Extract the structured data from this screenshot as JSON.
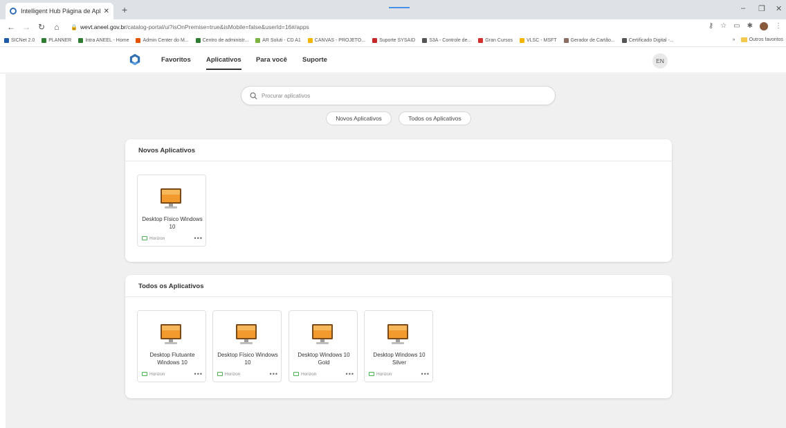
{
  "browser": {
    "tab_title": "Intelligent Hub Página de Aplica",
    "url_domain": "wevt.aneel.gov.br",
    "url_path": "/catalog-portal/ui?isOnPremise=true&isMobile=false&userId=16#/apps",
    "bookmarks": [
      {
        "label": "SICNet 2.0",
        "color": "#1e5aa8"
      },
      {
        "label": "PLANNER",
        "color": "#2e7d32"
      },
      {
        "label": "Intra ANEEL - Home",
        "color": "#2e7d32"
      },
      {
        "label": "Admin Center do M...",
        "color": "#e65100"
      },
      {
        "label": "Centro de administr...",
        "color": "#2e7d32"
      },
      {
        "label": "AR Soluti - CD A1",
        "color": "#7cb342"
      },
      {
        "label": "CANVAS - PROJETO...",
        "color": "#f4b400"
      },
      {
        "label": "Suporte SYSAID",
        "color": "#c62828"
      },
      {
        "label": "S3A - Controle de...",
        "color": "#555555"
      },
      {
        "label": "Gran Cursos",
        "color": "#d32f2f"
      },
      {
        "label": "VLSC - MSFT",
        "color": "#f4b400"
      },
      {
        "label": "Gerador de Cartão...",
        "color": "#8d6e63"
      },
      {
        "label": "Certificado Digital -...",
        "color": "#555555"
      }
    ],
    "other_bookmarks": "Outros favoritos"
  },
  "nav": {
    "items": [
      {
        "label": "Favoritos"
      },
      {
        "label": "Aplicativos"
      },
      {
        "label": "Para você"
      },
      {
        "label": "Suporte"
      }
    ],
    "language": "EN"
  },
  "search": {
    "placeholder": "Procurar aplicativos"
  },
  "filters": [
    {
      "label": "Novos Aplicativos"
    },
    {
      "label": "Todos os Aplicativos"
    }
  ],
  "sections": [
    {
      "title": "Novos Aplicativos",
      "apps": [
        {
          "name": "Desktop Físico Windows 10",
          "source": "Horizon"
        }
      ]
    },
    {
      "title": "Todos os Aplicativos",
      "apps": [
        {
          "name": "Desktop Flutuante Windows 10",
          "source": "Horizon"
        },
        {
          "name": "Desktop Físico Windows 10",
          "source": "Horizon"
        },
        {
          "name": "Desktop Windows 10 Gold",
          "source": "Horizon"
        },
        {
          "name": "Desktop Windows 10 Silver",
          "source": "Horizon"
        }
      ]
    }
  ],
  "colors": {
    "accent": "#2f6fb3",
    "horizon": "#4caf50",
    "background": "#f0f0f0"
  }
}
